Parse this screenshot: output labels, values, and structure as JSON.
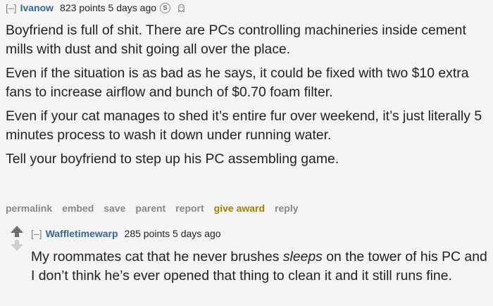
{
  "comment1": {
    "collapse": "[–]",
    "author": "Ivanow",
    "meta": "823 points 5 days ago",
    "badges": [
      "silver-award-icon",
      "ghost-award-icon"
    ],
    "paragraphs": [
      "Boyfriend is full of shit. There are PCs controlling machineries inside cement mills with dust and shit going all over the place.",
      "Even if the situation is as bad as he says, it could be fixed with two $10 extra fans to increase airflow and bunch of $0.70 foam filter.",
      "Even if your cat manages to shed it’s entire fur over weekend, it’s just literally 5 minutes process to wash it down under running water.",
      "Tell your boyfriend to step up his PC assembling game."
    ],
    "buttons": [
      "permalink",
      "embed",
      "save",
      "parent",
      "report",
      "give award",
      "reply"
    ]
  },
  "comment2": {
    "collapse": "[–]",
    "author": "Waffletimewarp",
    "meta": "285 points 5 days ago",
    "text_before": "My roommates cat that he never brushes ",
    "text_em": "sleeps",
    "text_after": " on the tower of his PC and I don’t think he’s ever opened that thing to clean it and it still runs fine."
  },
  "colors": {
    "author": "#336699",
    "background": "#f4f4f4",
    "award": "#a08000"
  }
}
